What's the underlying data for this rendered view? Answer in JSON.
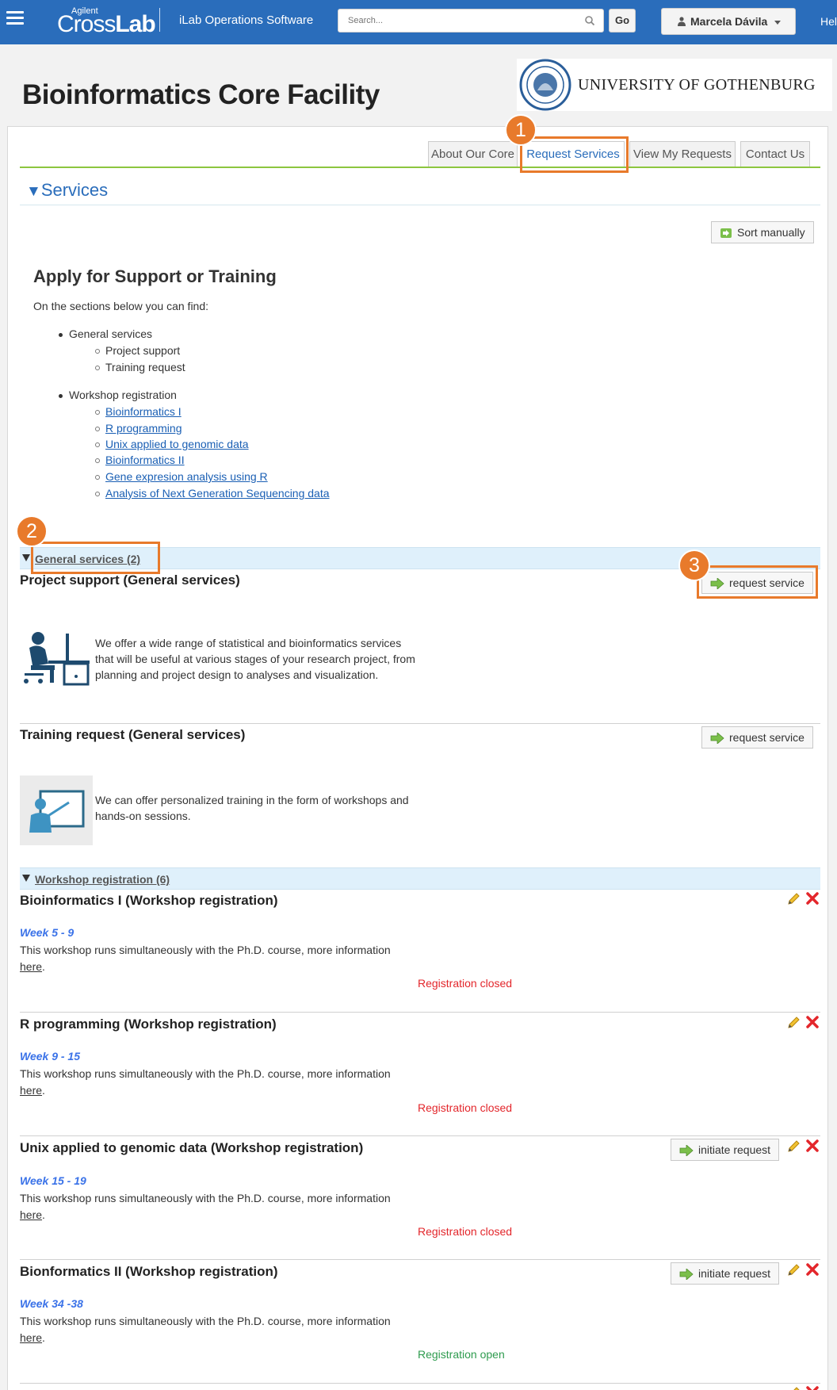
{
  "topbar": {
    "logo_small": "Agilent",
    "logo_cross": "Cross",
    "logo_lab": "Lab",
    "app_name": "iLab Operations Software",
    "search_placeholder": "Search...",
    "go_label": "Go",
    "user_name": "Marcela Dávila",
    "help_label": "Hel"
  },
  "header": {
    "page_title": "Bioinformatics Core Facility",
    "university_name": "UNIVERSITY OF GOTHENBURG"
  },
  "tabs": [
    {
      "label": "About Our Core",
      "active": false
    },
    {
      "label": "Request Services",
      "active": true
    },
    {
      "label": "View My Requests",
      "active": false
    },
    {
      "label": "Contact Us",
      "active": false
    }
  ],
  "services": {
    "heading": "Services",
    "sort_button": "Sort manually",
    "intro_title": "Apply for Support or Training",
    "intro_text": "On the sections below you can find:",
    "list": [
      {
        "label": "General services",
        "children": [
          "Project support",
          "Training request"
        ]
      },
      {
        "label": "Workshop registration",
        "children": [
          "Bioinformatics I",
          "R programming",
          "Unix applied to genomic data",
          "Bioinformatics II",
          "Gene expresion analysis using R",
          "Analysis of Next Generation Sequencing data"
        ]
      }
    ]
  },
  "general_section": {
    "label": "General services (2)",
    "items": [
      {
        "title": "Project support (General services)",
        "button": "request service",
        "description": "We offer a wide range of statistical and bioinformatics services that will be useful at various stages of your research project, from planning and project design to analyses and visualization."
      },
      {
        "title": "Training request (General services)",
        "button": "request service",
        "description": "We can offer personalized training in the form of workshops and hands-on sessions."
      }
    ]
  },
  "workshop_section": {
    "label": "Workshop registration (6)",
    "items": [
      {
        "title": "Bioinformatics I (Workshop registration)",
        "week": "Week 5 - 9",
        "description": "This workshop runs simultaneously with the Ph.D. course, more information",
        "link": "here",
        "status": "Registration closed",
        "button": ""
      },
      {
        "title": "R programming (Workshop registration)",
        "week": "Week 9 - 15",
        "description": "This workshop runs simultaneously with the Ph.D. course, more information",
        "link": "here",
        "status": "Registration closed",
        "button": ""
      },
      {
        "title": "Unix applied to genomic data (Workshop registration)",
        "week": "Week 15 - 19",
        "description": "This workshop runs simultaneously with the Ph.D. course, more information",
        "link": "here",
        "status": "Registration closed",
        "button": "initiate request"
      },
      {
        "title": "Bionformatics II (Workshop registration)",
        "week": "Week 34 -38",
        "description": "This workshop runs simultaneously with the Ph.D. course, more information",
        "link": "here",
        "status": "Registration open",
        "button": "initiate request"
      }
    ]
  },
  "callouts": [
    "1",
    "2",
    "3"
  ],
  "colors": {
    "topbar": "#2a6dbb",
    "accent_orange": "#e87a2b",
    "tab_line_green": "#8cc63f",
    "closed_red": "#e3262b",
    "open_green": "#2e9b4e",
    "section_bar": "#dff0fb"
  }
}
